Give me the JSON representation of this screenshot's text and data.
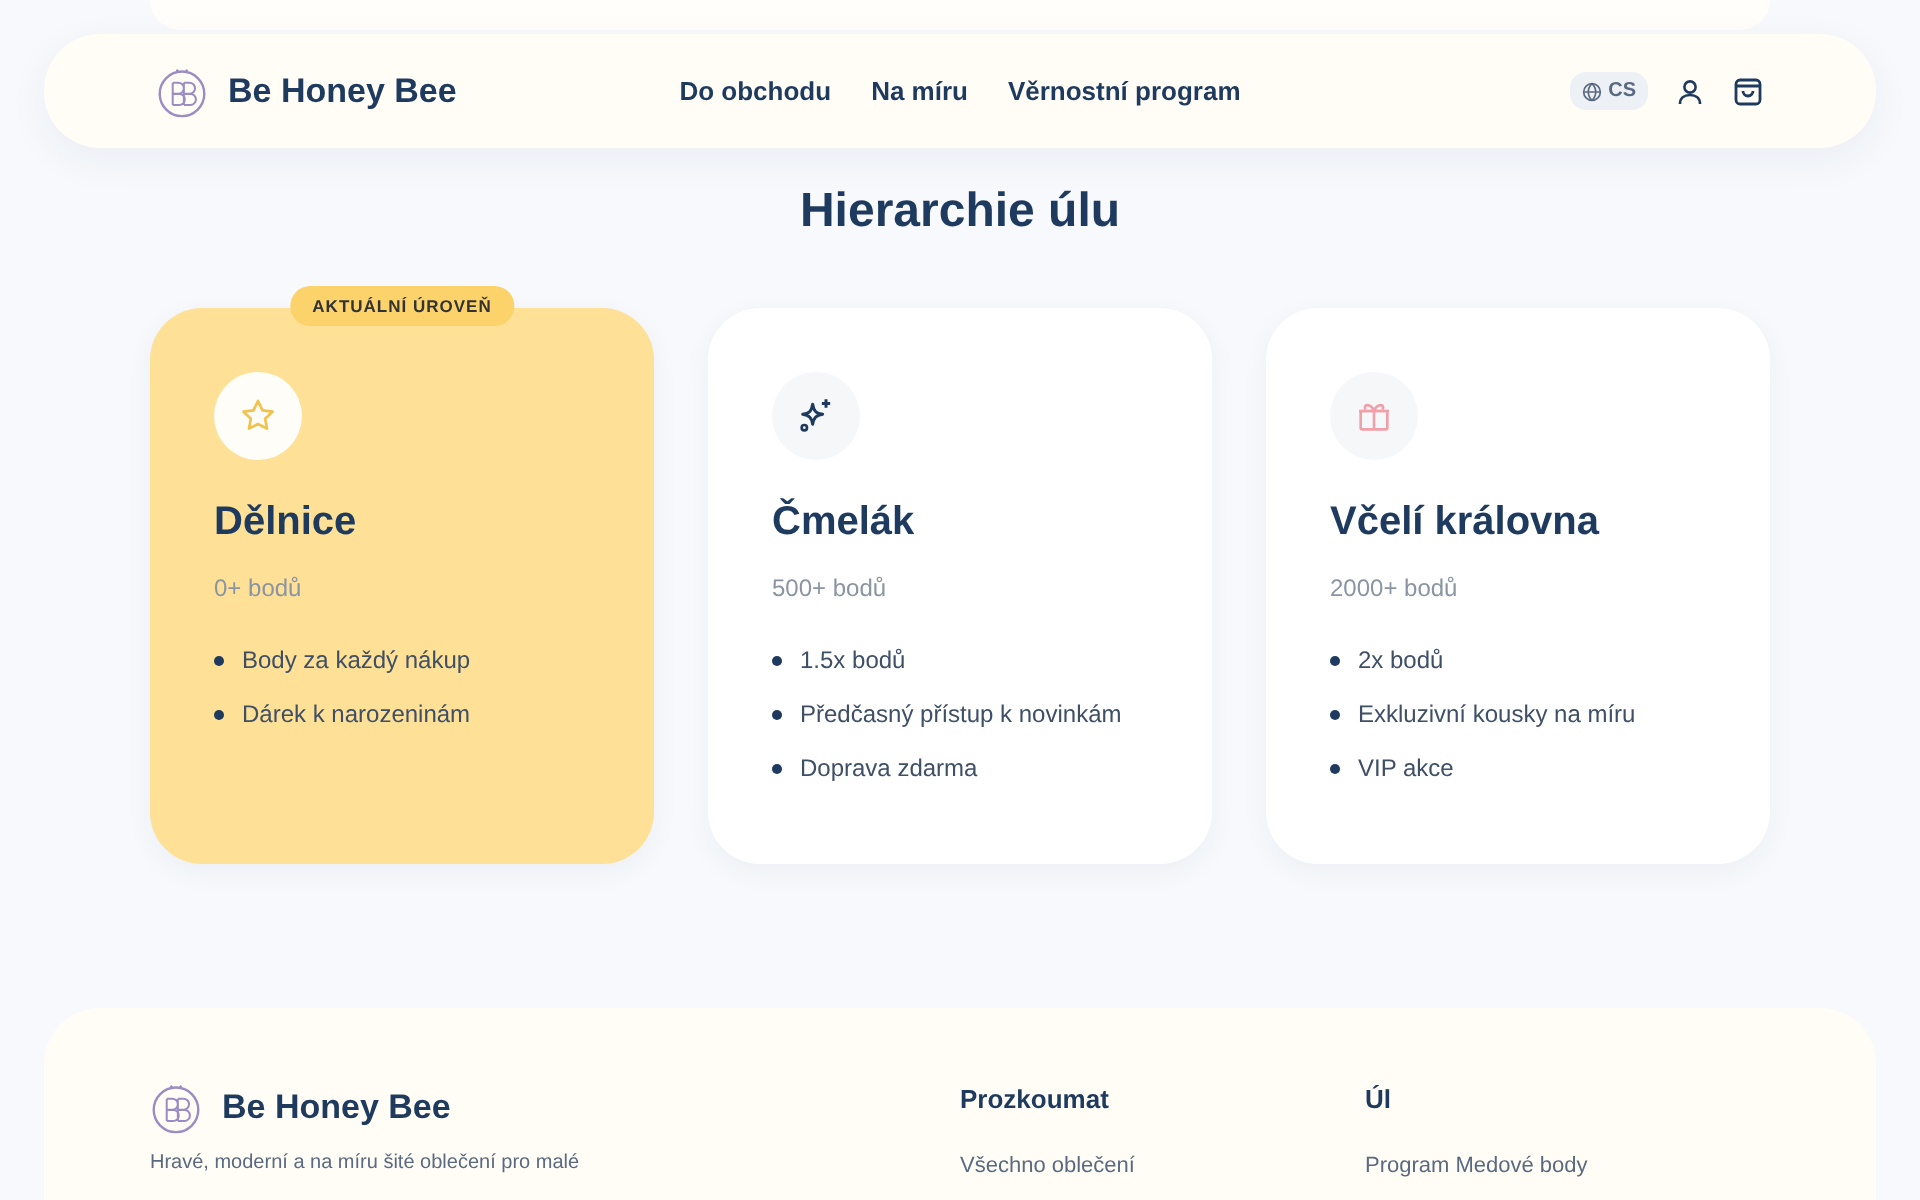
{
  "header": {
    "brand": "Be Honey Bee",
    "nav": [
      {
        "label": "Do obchodu"
      },
      {
        "label": "Na míru"
      },
      {
        "label": "Věrnostní program"
      }
    ],
    "language": "CS"
  },
  "section": {
    "title": "Hierarchie úlu"
  },
  "tiers": [
    {
      "name": "Dělnice",
      "points": "0+ bodů",
      "current": true,
      "badge": "AKTUÁLNÍ ÚROVEŇ",
      "perks": [
        "Body za každý nákup",
        "Dárek k narozeninám"
      ]
    },
    {
      "name": "Čmelák",
      "points": "500+ bodů",
      "current": false,
      "perks": [
        "1.5x bodů",
        "Předčasný přístup k novinkám",
        "Doprava zdarma"
      ]
    },
    {
      "name": "Včelí královna",
      "points": "2000+ bodů",
      "current": false,
      "perks": [
        "2x bodů",
        "Exkluzivní kousky na míru",
        "VIP akce"
      ]
    }
  ],
  "footer": {
    "brand": "Be Honey Bee",
    "description": "Hravé, moderní a na míru šité oblečení pro malé",
    "columns": [
      {
        "title": "Prozkoumat",
        "links": [
          "Všechno oblečení"
        ]
      },
      {
        "title": "Úl",
        "links": [
          "Program Medové body"
        ]
      }
    ]
  }
}
